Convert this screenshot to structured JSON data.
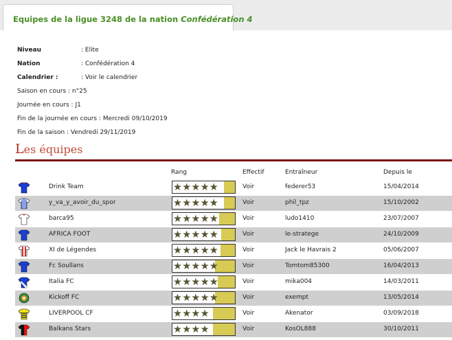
{
  "header": {
    "title_prefix": "Equipes de la ligue 3248 de la nation ",
    "title_nation": "Confédération 4"
  },
  "info": {
    "niveau_label": "Niveau",
    "niveau_value": ": Elite",
    "nation_label": "Nation",
    "nation_value": ": Confédération 4",
    "calendrier_label": "Calendrier :",
    "calendrier_link": ": Voir le calendrier",
    "saison": "Saison en cours : n°25",
    "journee": "Journée en cours : J1",
    "fin_journee": "Fin de la journée en cours : Mercredi 09/10/2019",
    "fin_saison": "Fin de la saison : Vendredi 29/11/2019"
  },
  "section": {
    "first_letter": "L",
    "rest": "es équipes"
  },
  "table": {
    "headers": {
      "rang": "Rang",
      "effectif": "Effectif",
      "entraineur": "Entraîneur",
      "depuis": "Depuis le"
    },
    "rows": [
      {
        "team": "Drink Team",
        "stars": "★★★★★",
        "rank_level": 0.82,
        "effectif": "Voir",
        "coach": "federer53",
        "since": "15/04/2014",
        "jersey": "blue-red-jersey-icon"
      },
      {
        "team": "y_va_y_avoir_du_spor",
        "stars": "★★★★★",
        "rank_level": 0.82,
        "effectif": "Voir",
        "coach": "phil_tpz",
        "since": "15/10/2002",
        "jersey": "blue-white-stripes-jersey-icon"
      },
      {
        "team": "barca95",
        "stars": "★★★★★",
        "rank_level": 0.75,
        "effectif": "Voir",
        "coach": "ludo1410",
        "since": "23/07/2007",
        "jersey": "white-red-jersey-icon"
      },
      {
        "team": "AFRICA FOOT",
        "stars": "★★★★★",
        "rank_level": 0.78,
        "effectif": "Voir",
        "coach": "le-stratege",
        "since": "24/10/2009",
        "jersey": "blue-jersey-icon"
      },
      {
        "team": "XI de Légendes",
        "stars": "★★★★★",
        "rank_level": 0.77,
        "effectif": "Voir",
        "coach": "Jack le Havrais 2",
        "since": "05/06/2007",
        "jersey": "red-white-stripes-jersey-icon"
      },
      {
        "team": "Fc Soullans",
        "stars": "★★★★★",
        "rank_level": 0.68,
        "effectif": "Voir",
        "coach": "Tomtom85300",
        "since": "16/04/2013",
        "jersey": "blue-jersey-icon"
      },
      {
        "team": "Italia FC",
        "stars": "★★★★★",
        "rank_level": 0.72,
        "effectif": "Voir",
        "coach": "mika004",
        "since": "14/03/2011",
        "jersey": "blue-white-sash-jersey-icon"
      },
      {
        "team": "Kickoff FC",
        "stars": "★★★★★",
        "rank_level": 0.68,
        "effectif": "Voir",
        "coach": "exempt",
        "since": "13/05/2014",
        "jersey": "green-orange-jersey-icon"
      },
      {
        "team": "LIVERPOOL CF",
        "stars": "★★★★",
        "rank_level": 0.65,
        "effectif": "Voir",
        "coach": "Akenator",
        "since": "03/09/2018",
        "jersey": "yellow-black-stripes-jersey-icon"
      },
      {
        "team": "Balkans Stars",
        "stars": "★★★★",
        "rank_level": 0.65,
        "effectif": "Voir",
        "coach": "KosOL888",
        "since": "30/10/2011",
        "jersey": "black-red-jersey-icon"
      }
    ]
  },
  "colors": {
    "title_green": "#4a8f27",
    "section_red": "#b42a1f",
    "rule_red": "#7a1414",
    "rank_fill": "#d8cb55"
  }
}
